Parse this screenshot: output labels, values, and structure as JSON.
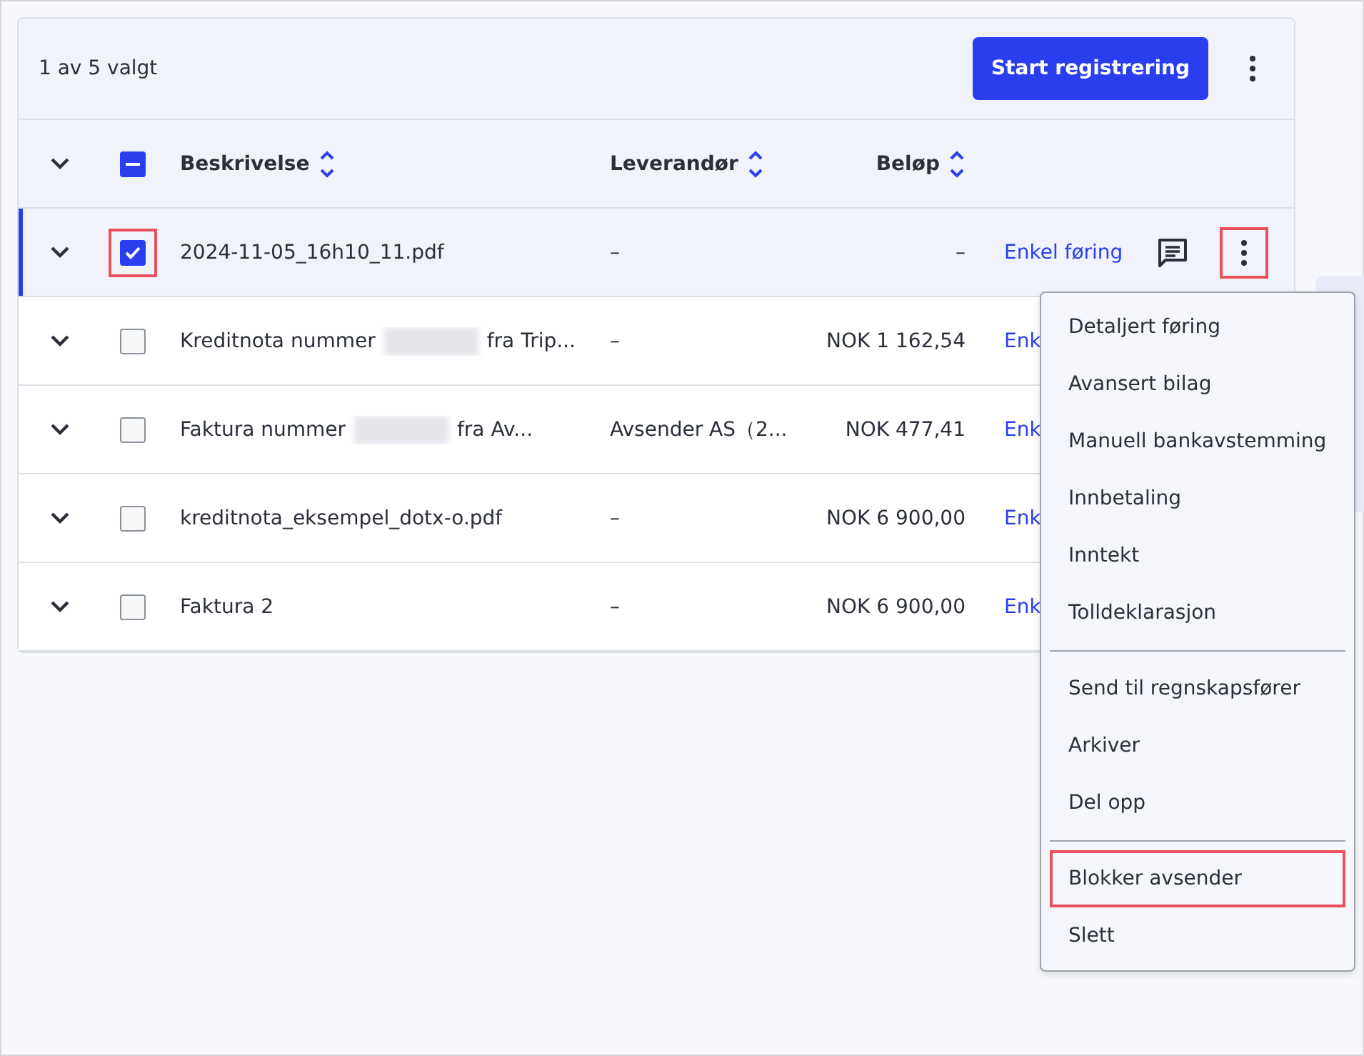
{
  "toolbar": {
    "selection_count": "1 av 5 valgt",
    "primary_button": "Start registrering"
  },
  "table": {
    "select_all": {
      "checked": true,
      "indeterminate": true
    },
    "columns": [
      "Beskrivelse",
      "Leverandør",
      "Beløp"
    ],
    "rows": [
      {
        "selected": true,
        "highlighted_checkbox": true,
        "description": "2024-11-05_16h10_11.pdf",
        "redacted": false,
        "supplier": "–",
        "amount": "–",
        "action": "Enkel føring",
        "actions_visible": true
      },
      {
        "selected": false,
        "highlighted_checkbox": false,
        "description": "Kreditnota nummer",
        "redacted": true,
        "description_suffix": "fra Trip...",
        "supplier": "–",
        "amount": "NOK 1 162,54",
        "action": "Enk",
        "actions_visible": false
      },
      {
        "selected": false,
        "highlighted_checkbox": false,
        "description": "Faktura nummer",
        "redacted": true,
        "description_suffix": "fra Av...",
        "supplier": "Avsender AS（2...",
        "amount": "NOK 477,41",
        "action": "Enk",
        "actions_visible": false
      },
      {
        "selected": false,
        "highlighted_checkbox": false,
        "description": "kreditnota_eksempel_dotx-o.pdf",
        "redacted": false,
        "supplier": "–",
        "amount": "NOK 6 900,00",
        "action": "Enk",
        "actions_visible": false
      },
      {
        "selected": false,
        "highlighted_checkbox": false,
        "description": "Faktura 2",
        "redacted": false,
        "supplier": "–",
        "amount": "NOK 6 900,00",
        "action": "Enk",
        "actions_visible": false
      }
    ]
  },
  "context_menu": {
    "groups": [
      [
        {
          "label": "Detaljert føring",
          "highlighted": false
        },
        {
          "label": "Avansert bilag",
          "highlighted": false
        },
        {
          "label": "Manuell bankavstemming",
          "highlighted": false
        },
        {
          "label": "Innbetaling",
          "highlighted": false
        },
        {
          "label": "Inntekt",
          "highlighted": false
        },
        {
          "label": "Tolldeklarasjon",
          "highlighted": false
        }
      ],
      [
        {
          "label": "Send til regnskapsfører",
          "highlighted": false
        },
        {
          "label": "Arkiver",
          "highlighted": false
        },
        {
          "label": "Del opp",
          "highlighted": false
        }
      ],
      [
        {
          "label": "Blokker avsender",
          "highlighted": true
        },
        {
          "label": "Slett",
          "highlighted": false
        }
      ]
    ]
  }
}
